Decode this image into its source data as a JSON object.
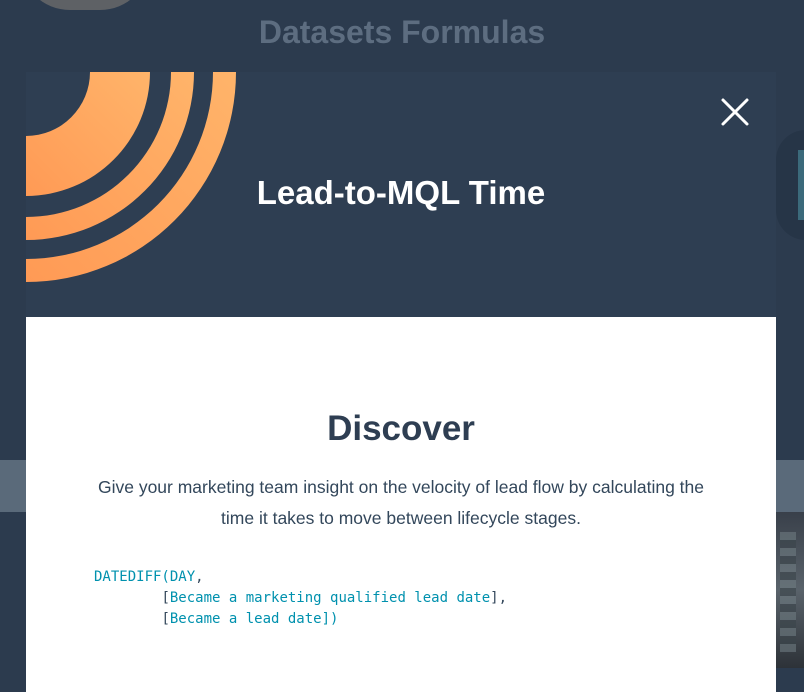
{
  "background": {
    "title": "Datasets Formulas"
  },
  "modal": {
    "title": "Lead-to-MQL Time",
    "section_title": "Discover",
    "description": "Give your marketing team insight on the velocity of lead flow by calculating the time it takes to move between lifecycle stages.",
    "code": {
      "line1_fn": "DATEDIFF(",
      "line1_arg": "DAY",
      "line1_end": ",",
      "line2_indent": "        ",
      "line2_open": "[",
      "line2_field": "Became a marketing qualified lead date",
      "line2_close": "],",
      "line3_indent": "        ",
      "line3_open": "[",
      "line3_field": "Became a lead date",
      "line3_close": "])"
    },
    "close_icon": "close-icon"
  },
  "colors": {
    "page_bg": "#2c3b4e",
    "header_bg": "#2e3e52",
    "accent_orange": "#ffa85c",
    "code_teal": "#0091ae",
    "text_dark": "#33475b"
  }
}
